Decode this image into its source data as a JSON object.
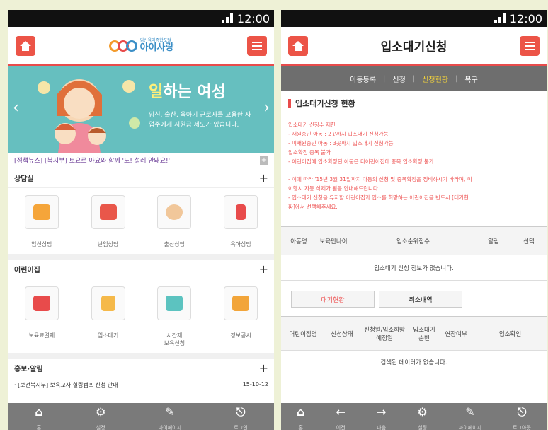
{
  "status": {
    "time": "12:00"
  },
  "left": {
    "logo": {
      "small": "임신육아종합포털",
      "name": "아이사랑"
    },
    "banner": {
      "title_highlight": "일",
      "title_rest": "하는 여성",
      "description": "임신, 출산, 육아기 근로자를 고용한 사업주에게 지원금 제도가 있습니다."
    },
    "news_ticker": "[정책뉴스] [복지부] 토요로 아요와 함께 '노! 설레 안돼요!'",
    "sections": [
      {
        "title": "상담실",
        "items": [
          {
            "label": "임신상담",
            "color": "#f5a53a"
          },
          {
            "label": "난임상담",
            "color": "#e9574a"
          },
          {
            "label": "출산상담",
            "color": "#f1c79a"
          },
          {
            "label": "육아상담",
            "color": "#e84b4b"
          }
        ]
      },
      {
        "title": "어린이집",
        "items": [
          {
            "label": "보육료결제",
            "color": "#e84b4b"
          },
          {
            "label": "입소대기",
            "color": "#f5b94a"
          },
          {
            "label": "시간제\n보육신청",
            "color": "#5cc3c0"
          },
          {
            "label": "정보공시",
            "color": "#f2a53a"
          }
        ]
      }
    ],
    "notice_section": {
      "title": "홍보·알림",
      "item": "· [보건복지부] 보육교사 힐링캠프 신청 안내",
      "date": "15-10-12"
    },
    "tabbar": [
      {
        "icon": "⌂",
        "label": "홈"
      },
      {
        "icon": "⚙",
        "label": "설정"
      },
      {
        "icon": "✎",
        "label": "마이페이지"
      },
      {
        "icon": "⎋",
        "label": "로그인"
      }
    ]
  },
  "right": {
    "title": "입소대기신청",
    "subnav": [
      "아동등록",
      "신청",
      "신청현황",
      "복구"
    ],
    "heading": "입소대기신청 현황",
    "rules": [
      "입소대기 신청수 제한",
      "- 재원중인 아동 : 2곳까지 입소대기 신청가능",
      "- 미재원중인 아동 : 3곳까지 입소대기 신청가능",
      "입소확정 중복 불가",
      "- 어린이집에 입소확정된 아동은 타어린이집에 중복 입소확정 불가"
    ],
    "notes": [
      "- 이에 따라 '15년 3월 31일까지 아동의 신청 및 중복확정을 정비하시기 바라며, 미",
      "이행시 자동 삭제가 됨을 안내해드립니다.",
      "- 입소대기 신청을 유지할 어린이집과 입소를 희망하는 어린이집을 반드시 [대기현",
      "황]에서 선택해주세요."
    ],
    "table1": {
      "headers": [
        "아동명",
        "보육만나이",
        "입소순위점수",
        "알림",
        "선택"
      ],
      "empty": "입소대기 신청 정보가 없습니다."
    },
    "buttons": [
      "대기현황",
      "취소내역"
    ],
    "table2": {
      "headers": [
        "어린이집명",
        "신청상태",
        "신청일/입소희망 예정일",
        "입소대기순번",
        "연장여부",
        "입소확인"
      ],
      "empty": "검색된 데이터가 없습니다."
    },
    "tabbar": [
      {
        "icon": "⌂",
        "label": "홈"
      },
      {
        "icon": "←",
        "label": "이전"
      },
      {
        "icon": "→",
        "label": "다음"
      },
      {
        "icon": "⚙",
        "label": "설정"
      },
      {
        "icon": "✎",
        "label": "마이페이지"
      },
      {
        "icon": "⎋",
        "label": "로그아웃"
      }
    ]
  }
}
